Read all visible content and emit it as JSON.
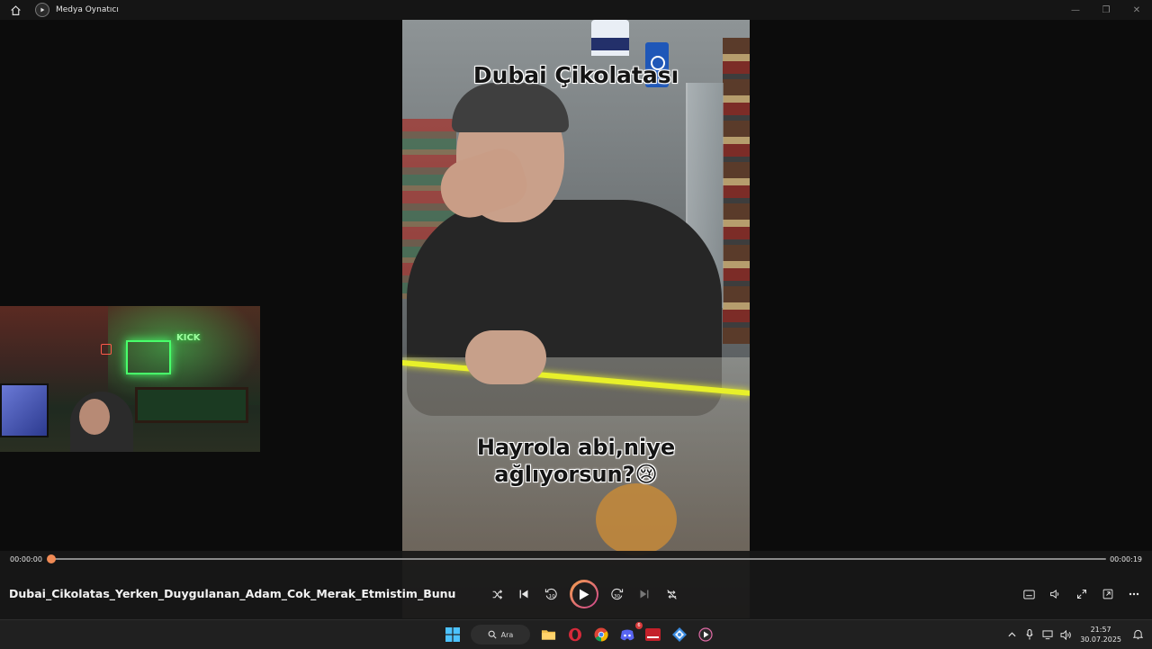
{
  "window": {
    "app_title": "Medya Oynatıcı",
    "controls": [
      "minimize-icon",
      "restore-icon",
      "close-icon"
    ]
  },
  "video": {
    "caption_top": "Dubai Çikolatası",
    "caption_bottom_line1": "Hayrola abi,niye",
    "caption_bottom_line2": "ağlıyorsun?😢"
  },
  "webcam": {
    "sign_text": "KICK"
  },
  "player": {
    "current_time": "00:00:00",
    "duration": "00:00:19",
    "progress": 0.0,
    "file_title": "Dubai_Cikolatas_Yerken_Duygulanan_Adam_Cok_Merak_Etmistim_Bunu",
    "skip_back_seconds": "10",
    "skip_forward_seconds": "30"
  },
  "taskbar": {
    "search_label": "Ara",
    "discord_badge": "6",
    "clock_time": "21:57",
    "clock_date": "30.07.2025"
  },
  "colors": {
    "accent_orange": "#f08a55",
    "accent_pink": "#d0458f",
    "bg": "#0c0c0c"
  }
}
